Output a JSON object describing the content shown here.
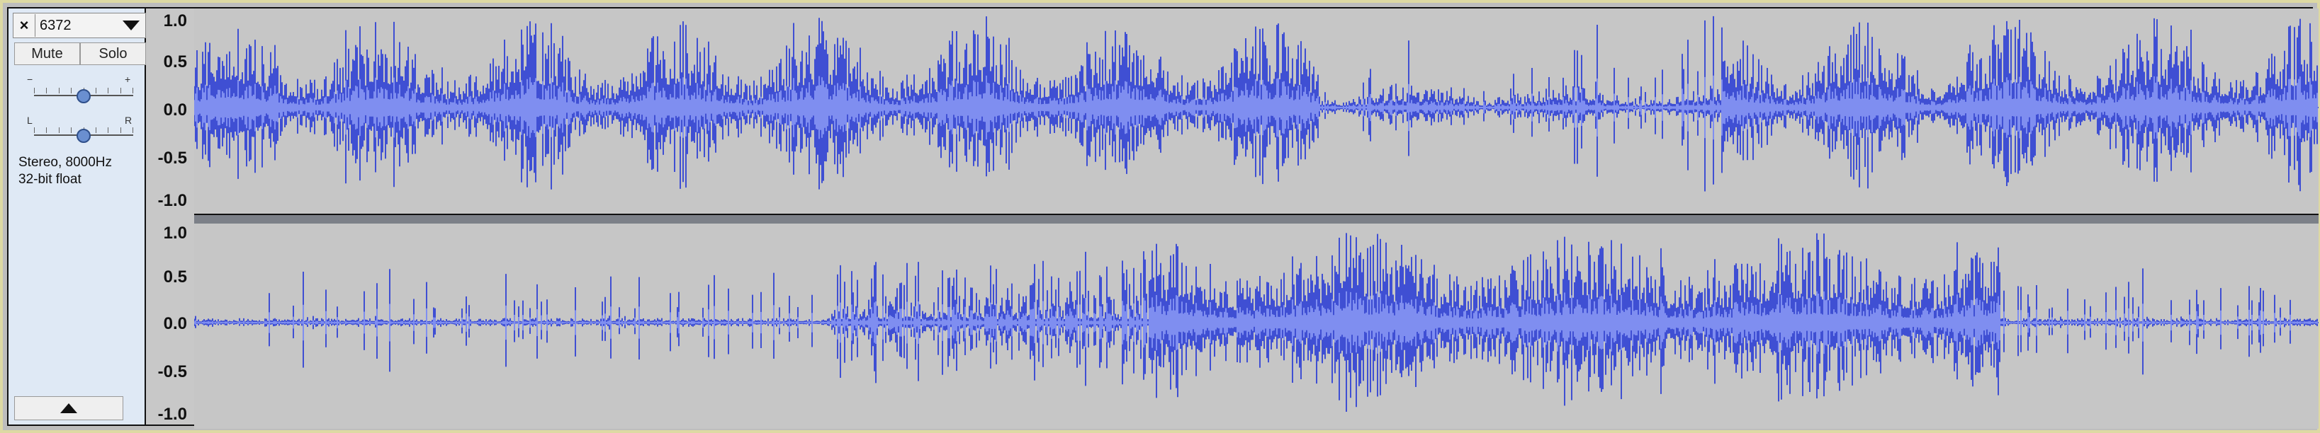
{
  "track": {
    "name": "6372",
    "close_glyph": "×",
    "mute_label": "Mute",
    "solo_label": "Solo",
    "gain": {
      "minus": "−",
      "plus": "+",
      "value": 0.5
    },
    "pan": {
      "left": "L",
      "right": "R",
      "value": 0.5
    },
    "format_line1": "Stereo, 8000Hz",
    "format_line2": "32-bit float"
  },
  "ruler": {
    "ticks": [
      "1.0",
      "0.5",
      "0.0",
      "-0.5",
      "-1.0"
    ]
  },
  "colors": {
    "waveform": "#3f4fd3",
    "waveform_rms": "#7f8ef0",
    "background": "#c6c6c6",
    "track_panel": "#dfe9f5"
  },
  "icons": {
    "close": "close-icon",
    "menu": "chevron-down-icon",
    "collapse": "chevron-up-icon"
  }
}
